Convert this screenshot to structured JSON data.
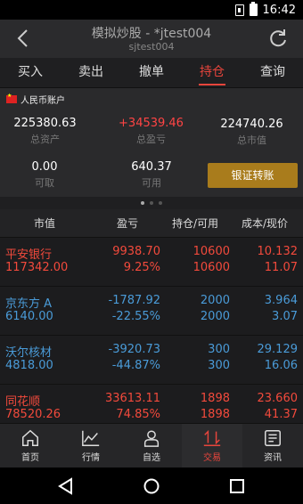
{
  "status": {
    "time": "16:42"
  },
  "header": {
    "title": "模拟炒股 - *jtest004",
    "subtitle": "sjtest004"
  },
  "tabs": [
    {
      "label": "买入"
    },
    {
      "label": "卖出"
    },
    {
      "label": "撤单"
    },
    {
      "label": "持仓",
      "active": true
    },
    {
      "label": "查询"
    }
  ],
  "account": {
    "label": "人民币账户",
    "total_assets": {
      "value": "225380.63",
      "label": "总资产"
    },
    "total_pnl": {
      "value": "+34539.46",
      "label": "总盈亏"
    },
    "market_value": {
      "value": "224740.26",
      "label": "总市值"
    },
    "withdrawable": {
      "value": "0.00",
      "label": "可取"
    },
    "available": {
      "value": "640.37",
      "label": "可用"
    },
    "transfer_label": "银证转账"
  },
  "table": {
    "headers": [
      "市值",
      "盈亏",
      "持仓/可用",
      "成本/现价"
    ],
    "rows": [
      {
        "name": "平安银行",
        "mv": "117342.00",
        "pnl": "9938.70",
        "pct": "9.25%",
        "hold": "10600",
        "avail": "10600",
        "cost": "10.132",
        "price": "11.07",
        "color": "red"
      },
      {
        "name": "京东方 A",
        "mv": "6140.00",
        "pnl": "-1787.92",
        "pct": "-22.55%",
        "hold": "2000",
        "avail": "2000",
        "cost": "3.964",
        "price": "3.07",
        "color": "blue"
      },
      {
        "name": "沃尔核材",
        "mv": "4818.00",
        "pnl": "-3920.73",
        "pct": "-44.87%",
        "hold": "300",
        "avail": "300",
        "cost": "29.129",
        "price": "16.06",
        "color": "blue"
      },
      {
        "name": "同花顺",
        "mv": "78520.26",
        "pnl": "33613.11",
        "pct": "74.85%",
        "hold": "1898",
        "avail": "1898",
        "cost": "23.660",
        "price": "41.37",
        "color": "red"
      }
    ]
  },
  "bottom_nav": [
    {
      "label": "首页",
      "icon": "home-icon"
    },
    {
      "label": "行情",
      "icon": "chart-icon"
    },
    {
      "label": "自选",
      "icon": "user-icon"
    },
    {
      "label": "交易",
      "icon": "trade-icon",
      "active": true
    },
    {
      "label": "资讯",
      "icon": "news-icon"
    }
  ]
}
